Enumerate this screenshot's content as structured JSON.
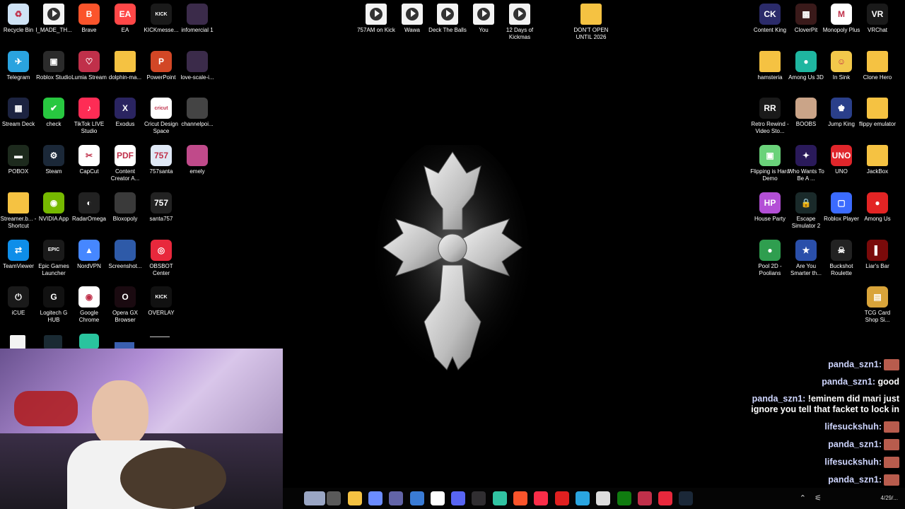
{
  "desktop": {
    "left_icons": [
      {
        "label": "Recycle Bin",
        "icon": "recycle-bin-icon",
        "color": "#cfe3f5",
        "glyph": "♻"
      },
      {
        "label": "I_MADE_TH...",
        "icon": "video-file-icon",
        "color": "#f3f3f3",
        "glyph": ""
      },
      {
        "label": "Brave",
        "icon": "brave-icon",
        "color": "#fb542b",
        "glyph": "B"
      },
      {
        "label": "EA",
        "icon": "ea-icon",
        "color": "#ff4747",
        "glyph": "EA"
      },
      {
        "label": "KICKmesse...",
        "icon": "kick-icon",
        "color": "#1a1a1a",
        "glyph": "KICK"
      },
      {
        "label": "infomercial 1",
        "icon": "image-file-icon",
        "color": "#3b2b4a",
        "glyph": ""
      },
      {
        "label": "Telegram",
        "icon": "telegram-icon",
        "color": "#2aa3df",
        "glyph": "✈"
      },
      {
        "label": "Roblox Studio",
        "icon": "roblox-studio-icon",
        "color": "#2b2b2b",
        "glyph": "▣"
      },
      {
        "label": "Lumia Stream",
        "icon": "lumia-stream-icon",
        "color": "#c0304a",
        "glyph": "♡"
      },
      {
        "label": "dolphin-ma...",
        "icon": "folder-icon",
        "color": "#f5c242",
        "glyph": ""
      },
      {
        "label": "PowerPoint",
        "icon": "powerpoint-icon",
        "color": "#d24726",
        "glyph": "P"
      },
      {
        "label": "love-scale-i...",
        "icon": "image-file-icon",
        "color": "#3b2b4a",
        "glyph": ""
      },
      {
        "label": "Stream Deck",
        "icon": "stream-deck-icon",
        "color": "#1c2340",
        "glyph": "▦"
      },
      {
        "label": "check",
        "icon": "check-icon",
        "color": "#28c840",
        "glyph": "✔"
      },
      {
        "label": "TikTok LIVE Studio",
        "icon": "tiktok-icon",
        "color": "#fe2c55",
        "glyph": "♪"
      },
      {
        "label": "Exodus",
        "icon": "exodus-icon",
        "color": "#2a2460",
        "glyph": "X"
      },
      {
        "label": "Cricut Design Space",
        "icon": "cricut-icon",
        "color": "#ffffff",
        "glyph": "cricut"
      },
      {
        "label": "channelpoi...",
        "icon": "image-file-icon",
        "color": "#444444",
        "glyph": ""
      },
      {
        "label": "POBOX",
        "icon": "pobox-icon",
        "color": "#1d2a1d",
        "glyph": "▬"
      },
      {
        "label": "Steam",
        "icon": "steam-icon",
        "color": "#1b2838",
        "glyph": "⚙"
      },
      {
        "label": "CapCut",
        "icon": "capcut-icon",
        "color": "#ffffff",
        "glyph": "✂"
      },
      {
        "label": "Content Creator A...",
        "icon": "pdf-icon",
        "color": "#ffffff",
        "glyph": "PDF"
      },
      {
        "label": "757santa",
        "icon": "image-file-icon",
        "color": "#dfe8f5",
        "glyph": "757"
      },
      {
        "label": "emely",
        "icon": "image-file-icon",
        "color": "#c04a8a",
        "glyph": ""
      },
      {
        "label": "Streamer.b... - Shortcut",
        "icon": "folder-icon",
        "color": "#f5c242",
        "glyph": ""
      },
      {
        "label": "NVIDIA App",
        "icon": "nvidia-icon",
        "color": "#76b900",
        "glyph": "◉"
      },
      {
        "label": "RadarOmega",
        "icon": "radar-omega-icon",
        "color": "#222222",
        "glyph": "◐"
      },
      {
        "label": "Bloxopoly",
        "icon": "image-file-icon",
        "color": "#3a3a3a",
        "glyph": ""
      },
      {
        "label": "santa757",
        "icon": "image-file-icon",
        "color": "#222222",
        "glyph": "757"
      },
      {
        "label": "TeamViewer",
        "icon": "teamviewer-icon",
        "color": "#0e8ee9",
        "glyph": "⇄"
      },
      {
        "label": "Epic Games Launcher",
        "icon": "epic-games-icon",
        "color": "#1a1a1a",
        "glyph": "EPIC"
      },
      {
        "label": "NordVPN",
        "icon": "nordvpn-icon",
        "color": "#4687ff",
        "glyph": "▲"
      },
      {
        "label": "Screenshot...",
        "icon": "image-file-icon",
        "color": "#2e5aa8",
        "glyph": ""
      },
      {
        "label": "OBSBOT Center",
        "icon": "obsbot-icon",
        "color": "#e8283c",
        "glyph": "◎"
      },
      {
        "label": "iCUE",
        "icon": "icue-icon",
        "color": "#1a1a1a",
        "glyph": "⏻"
      },
      {
        "label": "Logitech G HUB",
        "icon": "logitech-icon",
        "color": "#111111",
        "glyph": "G"
      },
      {
        "label": "Google Chrome",
        "icon": "chrome-icon",
        "color": "#ffffff",
        "glyph": "◉"
      },
      {
        "label": "Opera GX Browser",
        "icon": "opera-gx-icon",
        "color": "#1a0a10",
        "glyph": "O"
      },
      {
        "label": "OVERLAY",
        "icon": "overlay-icon",
        "color": "#111111",
        "glyph": "KICK"
      }
    ],
    "top_files": [
      {
        "label": "757AM on Kick",
        "icon": "video-file-icon"
      },
      {
        "label": "Wawa",
        "icon": "video-file-icon"
      },
      {
        "label": "Deck The Balls",
        "icon": "video-file-icon"
      },
      {
        "label": "You",
        "icon": "video-file-icon"
      },
      {
        "label": "12 Days of Kickmas",
        "icon": "video-file-icon"
      },
      {
        "label": "DON'T OPEN UNTIL 2026",
        "icon": "folder-icon"
      }
    ],
    "right_icons": [
      {
        "label": "Content King",
        "icon": "content-king-icon",
        "color": "#2b2b6a",
        "glyph": "CK"
      },
      {
        "label": "CloverPit",
        "icon": "cloverpit-icon",
        "color": "#3a1a1a",
        "glyph": "▩"
      },
      {
        "label": "Monopoly Plus",
        "icon": "monopoly-icon",
        "color": "#ffffff",
        "glyph": "M"
      },
      {
        "label": "VRChat",
        "icon": "vrchat-icon",
        "color": "#1a1a1a",
        "glyph": "VR"
      },
      {
        "label": "hamsteria",
        "icon": "folder-icon",
        "color": "#f5c242",
        "glyph": ""
      },
      {
        "label": "Among Us 3D",
        "icon": "among-us-3d-icon",
        "color": "#1fb6a0",
        "glyph": "●"
      },
      {
        "label": "In Sink",
        "icon": "in-sink-icon",
        "color": "#f2c84b",
        "glyph": "☺"
      },
      {
        "label": "Clone Hero",
        "icon": "folder-icon",
        "color": "#f5c242",
        "glyph": ""
      },
      {
        "label": "Retro Rewind - Video Sto...",
        "icon": "retro-rewind-icon",
        "color": "#1a1a1a",
        "glyph": "RR"
      },
      {
        "label": "BOOBS",
        "icon": "boobs-icon",
        "color": "#caa488",
        "glyph": ""
      },
      {
        "label": "Jump King",
        "icon": "jump-king-icon",
        "color": "#2a3f8a",
        "glyph": "♚"
      },
      {
        "label": "flippy emulator",
        "icon": "folder-icon",
        "color": "#f5c242",
        "glyph": ""
      },
      {
        "label": "Flipping is Hard Demo",
        "icon": "flipping-icon",
        "color": "#6ad27a",
        "glyph": "▣"
      },
      {
        "label": "Who Wants To Be A ...",
        "icon": "millionaire-icon",
        "color": "#2a1a5a",
        "glyph": "✦"
      },
      {
        "label": "UNO",
        "icon": "uno-icon",
        "color": "#e0262b",
        "glyph": "UNO"
      },
      {
        "label": "JackBox",
        "icon": "folder-icon",
        "color": "#f5c242",
        "glyph": ""
      },
      {
        "label": "House Party",
        "icon": "house-party-icon",
        "color": "#b34fd6",
        "glyph": "HP"
      },
      {
        "label": "Escape Simulator 2",
        "icon": "escape-sim-icon",
        "color": "#1a2a2a",
        "glyph": "🔒"
      },
      {
        "label": "Roblox Player",
        "icon": "roblox-icon",
        "color": "#3b6bff",
        "glyph": "▢"
      },
      {
        "label": "Among Us",
        "icon": "among-us-icon",
        "color": "#e32424",
        "glyph": "●"
      },
      {
        "label": "Pool 2D - Poolians",
        "icon": "pool-icon",
        "color": "#2f9e4f",
        "glyph": "●"
      },
      {
        "label": "Are You Smarter th...",
        "icon": "smarter-icon",
        "color": "#2a4faa",
        "glyph": "★"
      },
      {
        "label": "Buckshot Roulette",
        "icon": "buckshot-icon",
        "color": "#222222",
        "glyph": "☠"
      },
      {
        "label": "Liar's Bar",
        "icon": "liars-bar-icon",
        "color": "#7a0a0a",
        "glyph": "▌"
      },
      {
        "label": "TCG Card Shop Si...",
        "icon": "tcg-card-shop-icon",
        "color": "#d9a43a",
        "glyph": "▤"
      }
    ]
  },
  "chat": {
    "messages": [
      {
        "user": "panda_szn1:",
        "text": "",
        "avatar": true
      },
      {
        "user": "panda_szn1:",
        "text": "good",
        "avatar": false
      },
      {
        "user": "panda_szn1:",
        "text": "!eminem did mari just ignore you tell that facket to lock in",
        "avatar": false
      },
      {
        "user": "lifesuckshuh:",
        "text": "",
        "avatar": true
      },
      {
        "user": "panda_szn1:",
        "text": "",
        "avatar": true
      },
      {
        "user": "lifesuckshuh:",
        "text": "",
        "avatar": true
      },
      {
        "user": "panda_szn1:",
        "text": "",
        "avatar": true
      }
    ]
  },
  "taskbar": {
    "items": [
      {
        "icon": "weather-icon",
        "color": "#9aa6c4"
      },
      {
        "icon": "task-view-icon",
        "color": "#5a5a5a"
      },
      {
        "icon": "file-explorer-icon",
        "color": "#f5c242"
      },
      {
        "icon": "copilot-icon",
        "color": "#6b8cff"
      },
      {
        "icon": "teams-icon",
        "color": "#6264a7"
      },
      {
        "icon": "store-icon",
        "color": "#3a7bd5"
      },
      {
        "icon": "chrome-icon",
        "color": "#ffffff"
      },
      {
        "icon": "discord-icon",
        "color": "#5865f2"
      },
      {
        "icon": "obs-icon",
        "color": "#302e31"
      },
      {
        "icon": "streamlabs-icon",
        "color": "#31c3a2"
      },
      {
        "icon": "brave-icon",
        "color": "#fb542b"
      },
      {
        "icon": "music-icon",
        "color": "#fa2d48"
      },
      {
        "icon": "red-diamond-icon",
        "color": "#e02020"
      },
      {
        "icon": "edge-icon",
        "color": "#2aa5e0"
      },
      {
        "icon": "stack-icon",
        "color": "#dddddd"
      },
      {
        "icon": "xbox-icon",
        "color": "#107c10"
      },
      {
        "icon": "game-icon",
        "color": "#c0304a"
      },
      {
        "icon": "obsbot-icon",
        "color": "#e8283c"
      },
      {
        "icon": "steam-icon",
        "color": "#1b2838"
      }
    ],
    "clock": "4/29/..."
  }
}
